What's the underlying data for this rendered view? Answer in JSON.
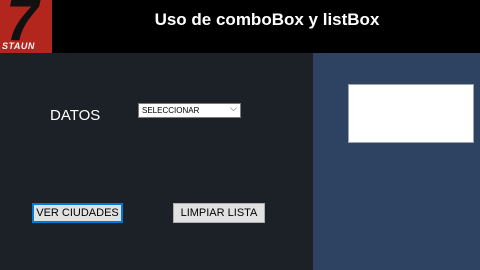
{
  "banner": {
    "logo_number": "7",
    "logo_text": "STAUN",
    "title": "Uso de comboBox y listBox"
  },
  "form": {
    "datos_label": "DATOS",
    "combo": {
      "selected": "SELECCIONAR"
    },
    "listbox": {
      "items": []
    },
    "ver_ciudades_label": "VER CIUDADES",
    "limpiar_lista_label": "LIMPIAR LISTA"
  },
  "colors": {
    "form_bg": "#1c2128",
    "panel_bg": "#2e4262",
    "logo_bg": "#b3261e",
    "focus_border": "#0078d7"
  }
}
